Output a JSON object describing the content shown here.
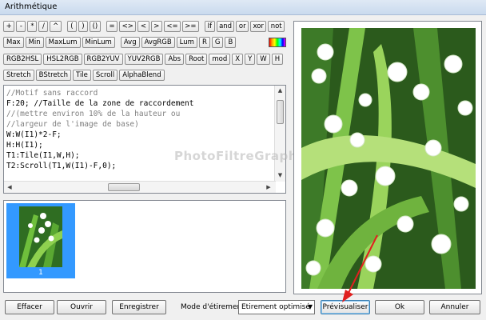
{
  "window": {
    "title": "Arithmétique"
  },
  "colors": {
    "accent": "#3399ff",
    "arrow": "#e0201f"
  },
  "rows": {
    "row1": [
      "+",
      "-",
      "*",
      "/",
      "^",
      "(",
      ")",
      "()",
      "=",
      "<>",
      "<",
      ">",
      "<=",
      ">=",
      "If",
      "and",
      "or",
      "xor",
      "not"
    ],
    "row2": [
      "Max",
      "Min",
      "MaxLum",
      "MinLum",
      "Avg",
      "AvgRGB",
      "Lum",
      "R",
      "G",
      "B"
    ],
    "row3": [
      "RGB2HSL",
      "HSL2RGB",
      "RGB2YUV",
      "YUV2RGB",
      "Abs",
      "Root",
      "mod",
      "X",
      "Y",
      "W",
      "H"
    ],
    "row4": [
      "Stretch",
      "BStretch",
      "Tile",
      "Scroll",
      "AlphaBlend"
    ]
  },
  "editor": {
    "lines": [
      "//Motif sans raccord",
      "F:20; //Taille de la zone de raccordement",
      "//(mettre environ 10% de la hauteur ou",
      "//largeur de l'image de base)",
      "W:W(I1)*2-F;",
      "H:H(I1);",
      "T1:Tile(I1,W,H);",
      "T2:Scroll(T1,W(I1)-F,0);"
    ]
  },
  "watermark": "PhotoFiltreGraphic",
  "thumbnail": {
    "caption": "1"
  },
  "bottom": {
    "clear": "Effacer",
    "open": "Ouvrir",
    "save": "Enregistrer",
    "stretch_label": "Mode d'étirement",
    "stretch_value": "Etirement optimisé",
    "preview": "Prévisualiser",
    "ok": "Ok",
    "cancel": "Annuler"
  }
}
